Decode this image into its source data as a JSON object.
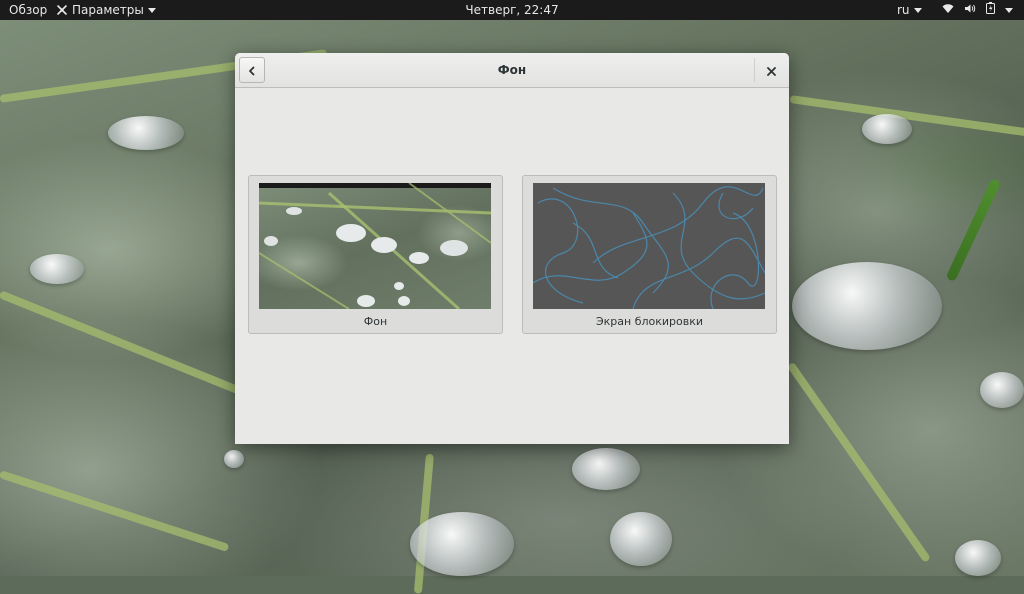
{
  "topbar": {
    "overview": "Обзор",
    "app_name": "Параметры",
    "clock": "Четверг, 22:47",
    "language": "ru",
    "icons": [
      "wifi-icon",
      "volume-icon",
      "battery-icon",
      "chevron-down-icon"
    ]
  },
  "dialog": {
    "title": "Фон",
    "back_icon": "chevron-left-icon",
    "close_icon": "close-icon",
    "cards": [
      {
        "label": "Фон",
        "preview": "wallpaper-leaf-drops"
      },
      {
        "label": "Экран блокировки",
        "preview": "lockscreen-blue-lines"
      }
    ]
  },
  "colors": {
    "topbar": "#1b1b1b",
    "dialog_bg": "#e8e8e7",
    "lock_bg": "#565656",
    "lock_lines": "#4a90b8"
  }
}
